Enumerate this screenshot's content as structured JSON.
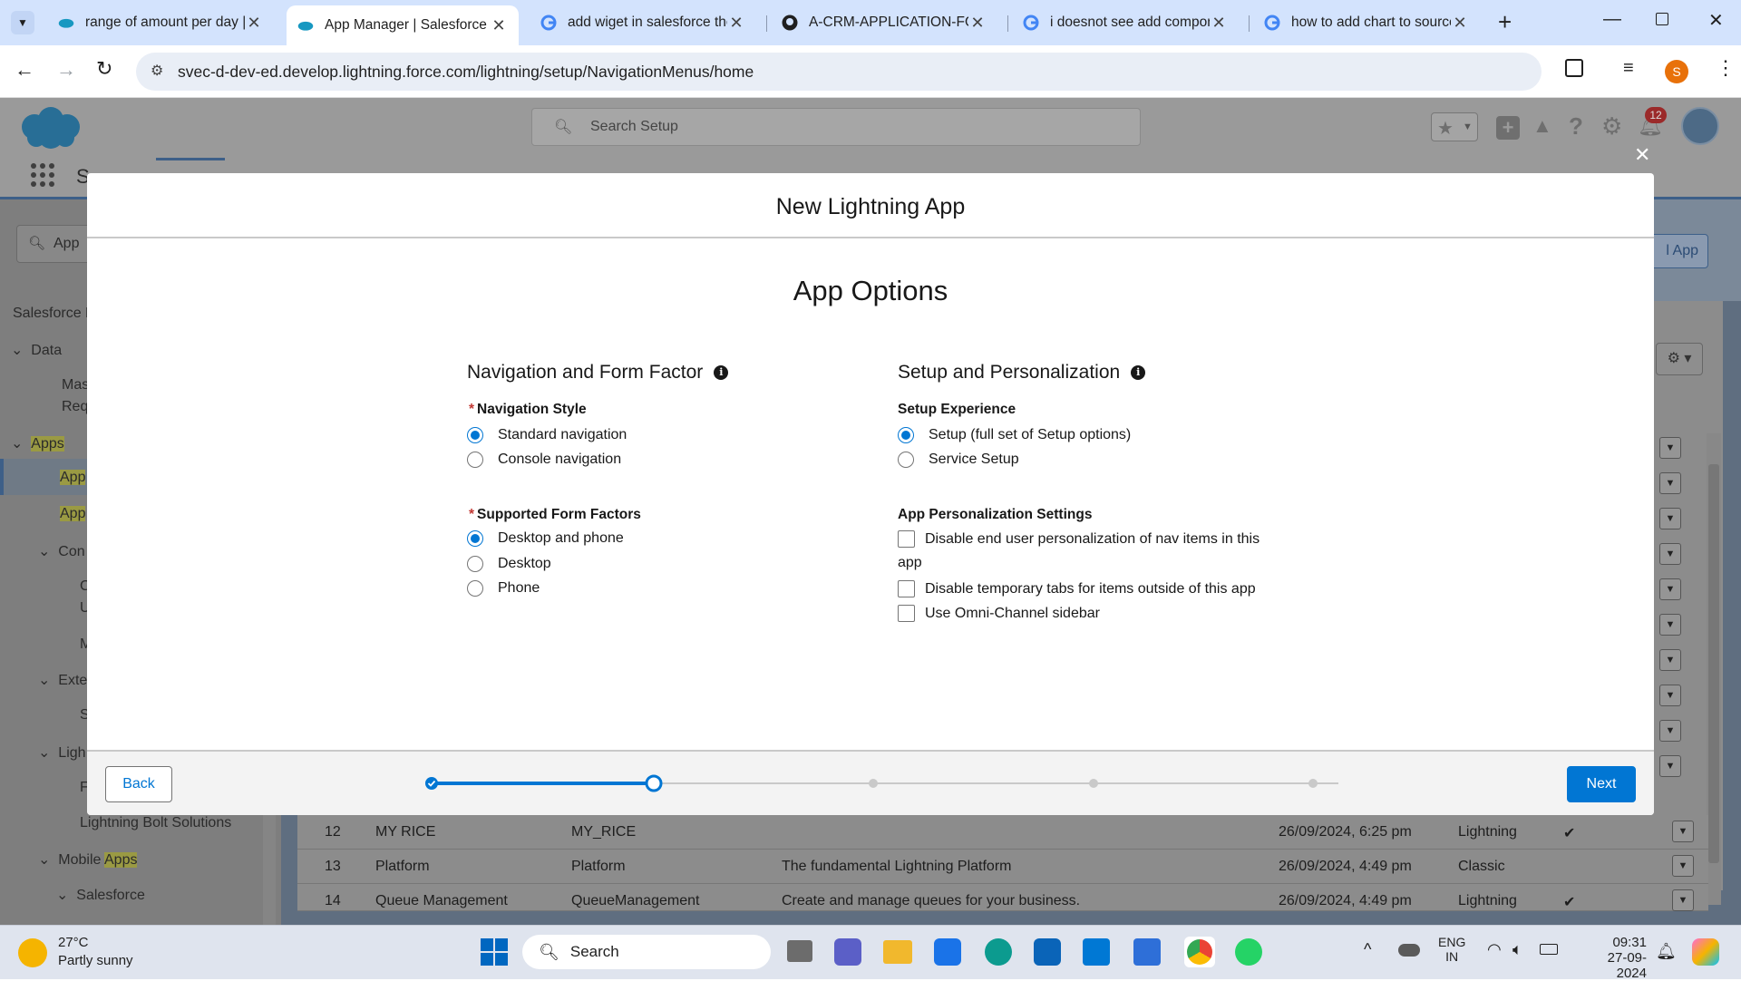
{
  "browser": {
    "tabs": [
      {
        "label": "range of amount per day |",
        "icon": "google-icon"
      },
      {
        "label": "App Manager | Salesforce",
        "icon": "salesforce-icon",
        "active": true
      },
      {
        "label": "add wiget in salesforce the",
        "icon": "google-icon"
      },
      {
        "label": "A-CRM-APPLICATION-FOR",
        "icon": "github-icon"
      },
      {
        "label": "i doesnot see add compon",
        "icon": "google-icon"
      },
      {
        "label": "how to add chart to source",
        "icon": "google-icon"
      }
    ],
    "url": "svec-d-dev-ed.develop.lightning.force.com/lightning/setup/NavigationMenus/home",
    "profile_initial": "S"
  },
  "salesforce": {
    "search_placeholder": "Search Setup",
    "notification_count": "12",
    "app_name_partial": "S",
    "quickfind_value": "App",
    "new_app_btn_partial": "l App"
  },
  "leftnav": {
    "items": [
      {
        "label": "Salesforce M"
      },
      {
        "label": "Data"
      },
      {
        "label": "Mas"
      },
      {
        "label": "Req"
      },
      {
        "label": "Apps"
      },
      {
        "label": "App"
      },
      {
        "label": "App"
      },
      {
        "label": "Con"
      },
      {
        "label": "C"
      },
      {
        "label": "U"
      },
      {
        "label": "M"
      },
      {
        "label": "Exte"
      },
      {
        "label": "S"
      },
      {
        "label": "Ligh"
      },
      {
        "label": "F"
      },
      {
        "label": "Lightning Bolt Solutions"
      },
      {
        "label": "Mobile"
      },
      {
        "label": "Apps"
      },
      {
        "label": "Salesforce"
      }
    ]
  },
  "bg_table": {
    "rows": [
      {
        "num": "12",
        "name": "MY RICE",
        "dev": "MY_RICE",
        "desc": "",
        "date": "26/09/2024, 6:25 pm",
        "type": "Lightning",
        "check": "✔"
      },
      {
        "num": "13",
        "name": "Platform",
        "dev": "Platform",
        "desc": "The fundamental Lightning Platform",
        "date": "26/09/2024, 4:49 pm",
        "type": "Classic",
        "check": ""
      },
      {
        "num": "14",
        "name": "Queue Management",
        "dev": "QueueManagement",
        "desc": "Create and manage queues for your business.",
        "date": "26/09/2024, 4:49 pm",
        "type": "Lightning",
        "check": "✔"
      }
    ]
  },
  "modal": {
    "title": "New Lightning App",
    "subtitle": "App Options",
    "left_section": {
      "heading": "Navigation and Form Factor",
      "nav_style_label": "Navigation Style",
      "nav_options": [
        "Standard navigation",
        "Console navigation"
      ],
      "nav_selected": 0,
      "form_factor_label": "Supported Form Factors",
      "form_options": [
        "Desktop and phone",
        "Desktop",
        "Phone"
      ],
      "form_selected": 0
    },
    "right_section": {
      "heading": "Setup and Personalization",
      "setup_label": "Setup Experience",
      "setup_options": [
        "Setup (full set of Setup options)",
        "Service Setup"
      ],
      "setup_selected": 0,
      "personalization_label": "App Personalization Settings",
      "checkbox_1a": "Disable end user personalization of nav items in this",
      "checkbox_1b": "app",
      "checkbox_2": "Disable temporary tabs for items outside of this app",
      "checkbox_3": "Use Omni-Channel sidebar"
    },
    "back_label": "Back",
    "next_label": "Next",
    "progress": {
      "steps": 5,
      "current_step": 2
    }
  },
  "taskbar": {
    "weather_temp": "27°C",
    "weather_desc": "Partly sunny",
    "search_label": "Search",
    "lang_1": "ENG",
    "lang_2": "IN",
    "time": "09:31",
    "date": "27-09-2024"
  },
  "colors": {
    "brand": "#0176d3",
    "tabbar": "#d3e3fd",
    "required": "#c23934"
  }
}
